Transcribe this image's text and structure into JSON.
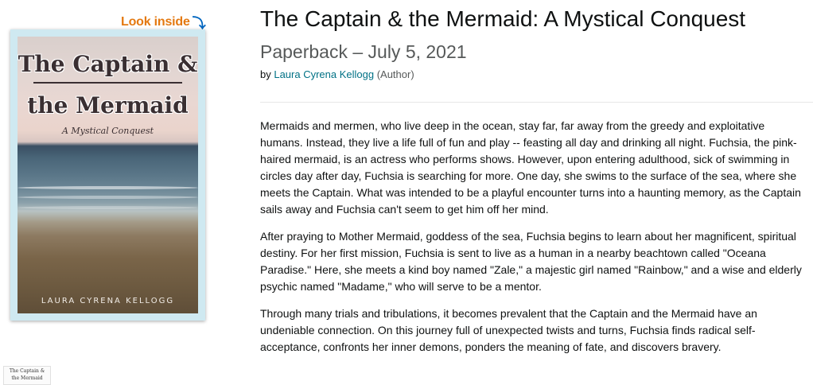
{
  "look_inside": {
    "label": "Look inside",
    "icon": "arrow-down-icon"
  },
  "cover": {
    "title_line1": "The Captain &",
    "title_line2": "the Mermaid",
    "subtitle": "A Mystical Conquest",
    "author": "LAURA CYRENA KELLOGG"
  },
  "thumbnail": {
    "line1": "The Captain &",
    "line2": "the Mermaid"
  },
  "product": {
    "title": "The Captain & the Mermaid: A Mystical Conquest",
    "format": "Paperback – July 5, 2021",
    "by_prefix": "by ",
    "author": "Laura Cyrena Kellogg",
    "author_role": " (Author)"
  },
  "description": {
    "paragraphs": [
      "Mermaids and mermen, who live deep in the ocean, stay far, far away from the greedy and exploitative humans. Instead, they live a life full of fun and play -- feasting all day and drinking all night. Fuchsia, the pink-haired mermaid, is an actress who performs shows. However, upon entering adulthood, sick of swimming in circles day after day, Fuchsia is searching for more. One day, she swims to the surface of the sea, where she meets the Captain. What was intended to be a playful encounter turns into a haunting memory, as the Captain sails away and Fuchsia can't seem to get him off her mind.",
      "After praying to Mother Mermaid, goddess of the sea, Fuchsia begins to learn about her magnificent, spiritual destiny. For her first mission, Fuchsia is sent to live as a human in a nearby beachtown called \"Oceana Paradise.\" Here, she meets a kind boy named \"Zale,\" a majestic girl named \"Rainbow,\" and a wise and elderly psychic named \"Madame,\" who will serve to be a mentor.",
      "Through many trials and tribulations, it becomes prevalent that the Captain and the Mermaid have an undeniable connection. On this journey full of unexpected twists and turns, Fuchsia finds radical self-acceptance, confronts her inner demons, ponders the meaning of fate, and discovers bravery."
    ]
  },
  "colors": {
    "look_inside": "#e47911",
    "link": "#007185",
    "secondary_text": "#565959",
    "text": "#0f1111"
  }
}
